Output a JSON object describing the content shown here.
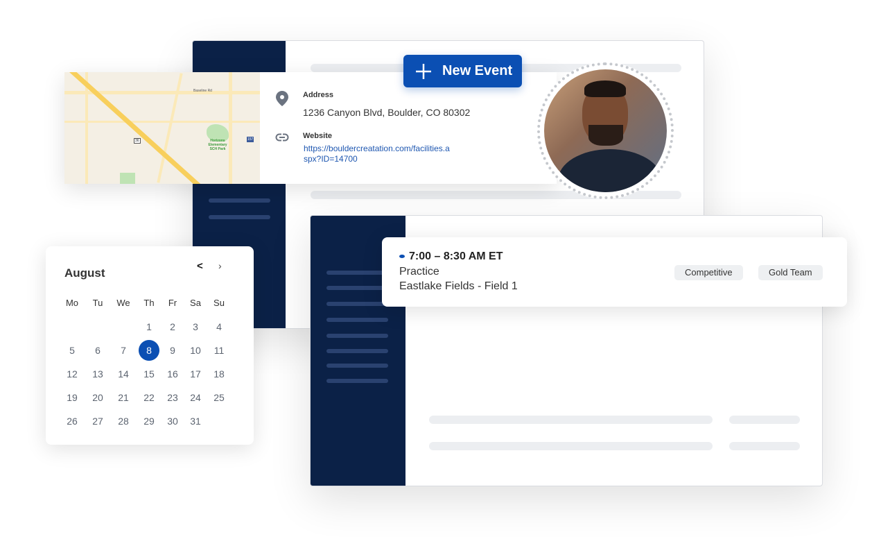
{
  "new_event_button": {
    "label": "New Event"
  },
  "location": {
    "address_label": "Address",
    "address": "1236 Canyon Blvd, Boulder, CO 80302",
    "website_label": "Website",
    "website": "https://bouldercreatation.com/facilities.aspx?ID=14700",
    "website_line1": "https://bouldercreatation.com/facilities.a",
    "website_line2": "spx?ID=14700"
  },
  "map": {
    "labels": [
      "Baseline Rd",
      "Horizons Elementary SCH Park",
      "36",
      "157"
    ]
  },
  "calendar": {
    "month": "August",
    "prev": "<",
    "next": "›",
    "weekdays": [
      "Mo",
      "Tu",
      "We",
      "Th",
      "Fr",
      "Sa",
      "Su"
    ],
    "weeks": [
      [
        "",
        "",
        "",
        "1",
        "2",
        "3",
        "4"
      ],
      [
        "5",
        "6",
        "7",
        "8",
        "9",
        "10",
        "11"
      ],
      [
        "12",
        "13",
        "14",
        "15",
        "16",
        "17",
        "18"
      ],
      [
        "19",
        "20",
        "21",
        "22",
        "23",
        "24",
        "25"
      ],
      [
        "26",
        "27",
        "28",
        "29",
        "30",
        "31",
        ""
      ]
    ],
    "selected": "8"
  },
  "event": {
    "time": "7:00 – 8:30 AM ET",
    "title": "Practice",
    "location": "Eastlake Fields - Field 1",
    "tags": [
      "Competitive",
      "Gold Team"
    ]
  },
  "colors": {
    "navy": "#0b2147",
    "accent": "#0b4fb3"
  }
}
